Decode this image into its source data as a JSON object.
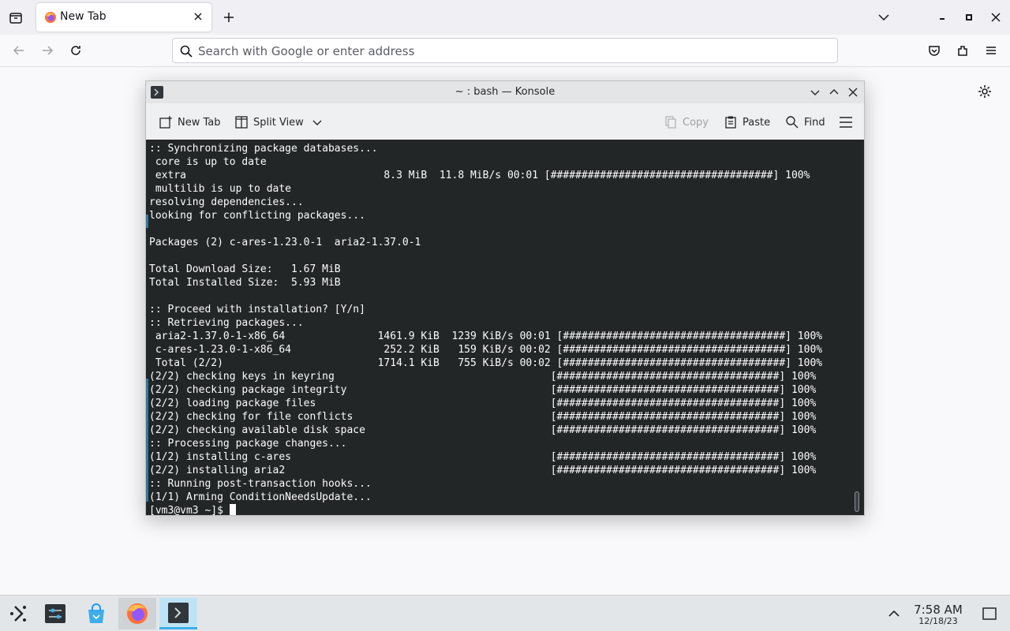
{
  "browser": {
    "tab_title": "New Tab",
    "address_placeholder": "Search with Google or enter address"
  },
  "konsole": {
    "window_title": "~ : bash — Konsole",
    "toolbar": {
      "new_tab": "New Tab",
      "split_view": "Split View",
      "copy": "Copy",
      "paste": "Paste",
      "find": "Find"
    },
    "terminal_lines": [
      ":: Synchronizing package databases...",
      " core is up to date",
      " extra                                8.3 MiB  11.8 MiB/s 00:01 [####################################] 100%",
      " multilib is up to date",
      "resolving dependencies...",
      "looking for conflicting packages...",
      "",
      "Packages (2) c-ares-1.23.0-1  aria2-1.37.0-1",
      "",
      "Total Download Size:   1.67 MiB",
      "Total Installed Size:  5.93 MiB",
      "",
      ":: Proceed with installation? [Y/n]",
      ":: Retrieving packages...",
      " aria2-1.37.0-1-x86_64               1461.9 KiB  1239 KiB/s 00:01 [####################################] 100%",
      " c-ares-1.23.0-1-x86_64               252.2 KiB   159 KiB/s 00:02 [####################################] 100%",
      " Total (2/2)                         1714.1 KiB   755 KiB/s 00:02 [####################################] 100%",
      "(2/2) checking keys in keyring                                   [####################################] 100%",
      "(2/2) checking package integrity                                 [####################################] 100%",
      "(2/2) loading package files                                      [####################################] 100%",
      "(2/2) checking for file conflicts                                [####################################] 100%",
      "(2/2) checking available disk space                              [####################################] 100%",
      ":: Processing package changes...",
      "(1/2) installing c-ares                                          [####################################] 100%",
      "(2/2) installing aria2                                           [####################################] 100%",
      ":: Running post-transaction hooks...",
      "(1/1) Arming ConditionNeedsUpdate..."
    ],
    "prompt": "[vm3@vm3 ~]$ "
  },
  "taskbar": {
    "time": "7:58 AM",
    "date": "12/18/23"
  },
  "colors": {
    "terminal_bg": "#232627",
    "accent": "#3daee9"
  }
}
